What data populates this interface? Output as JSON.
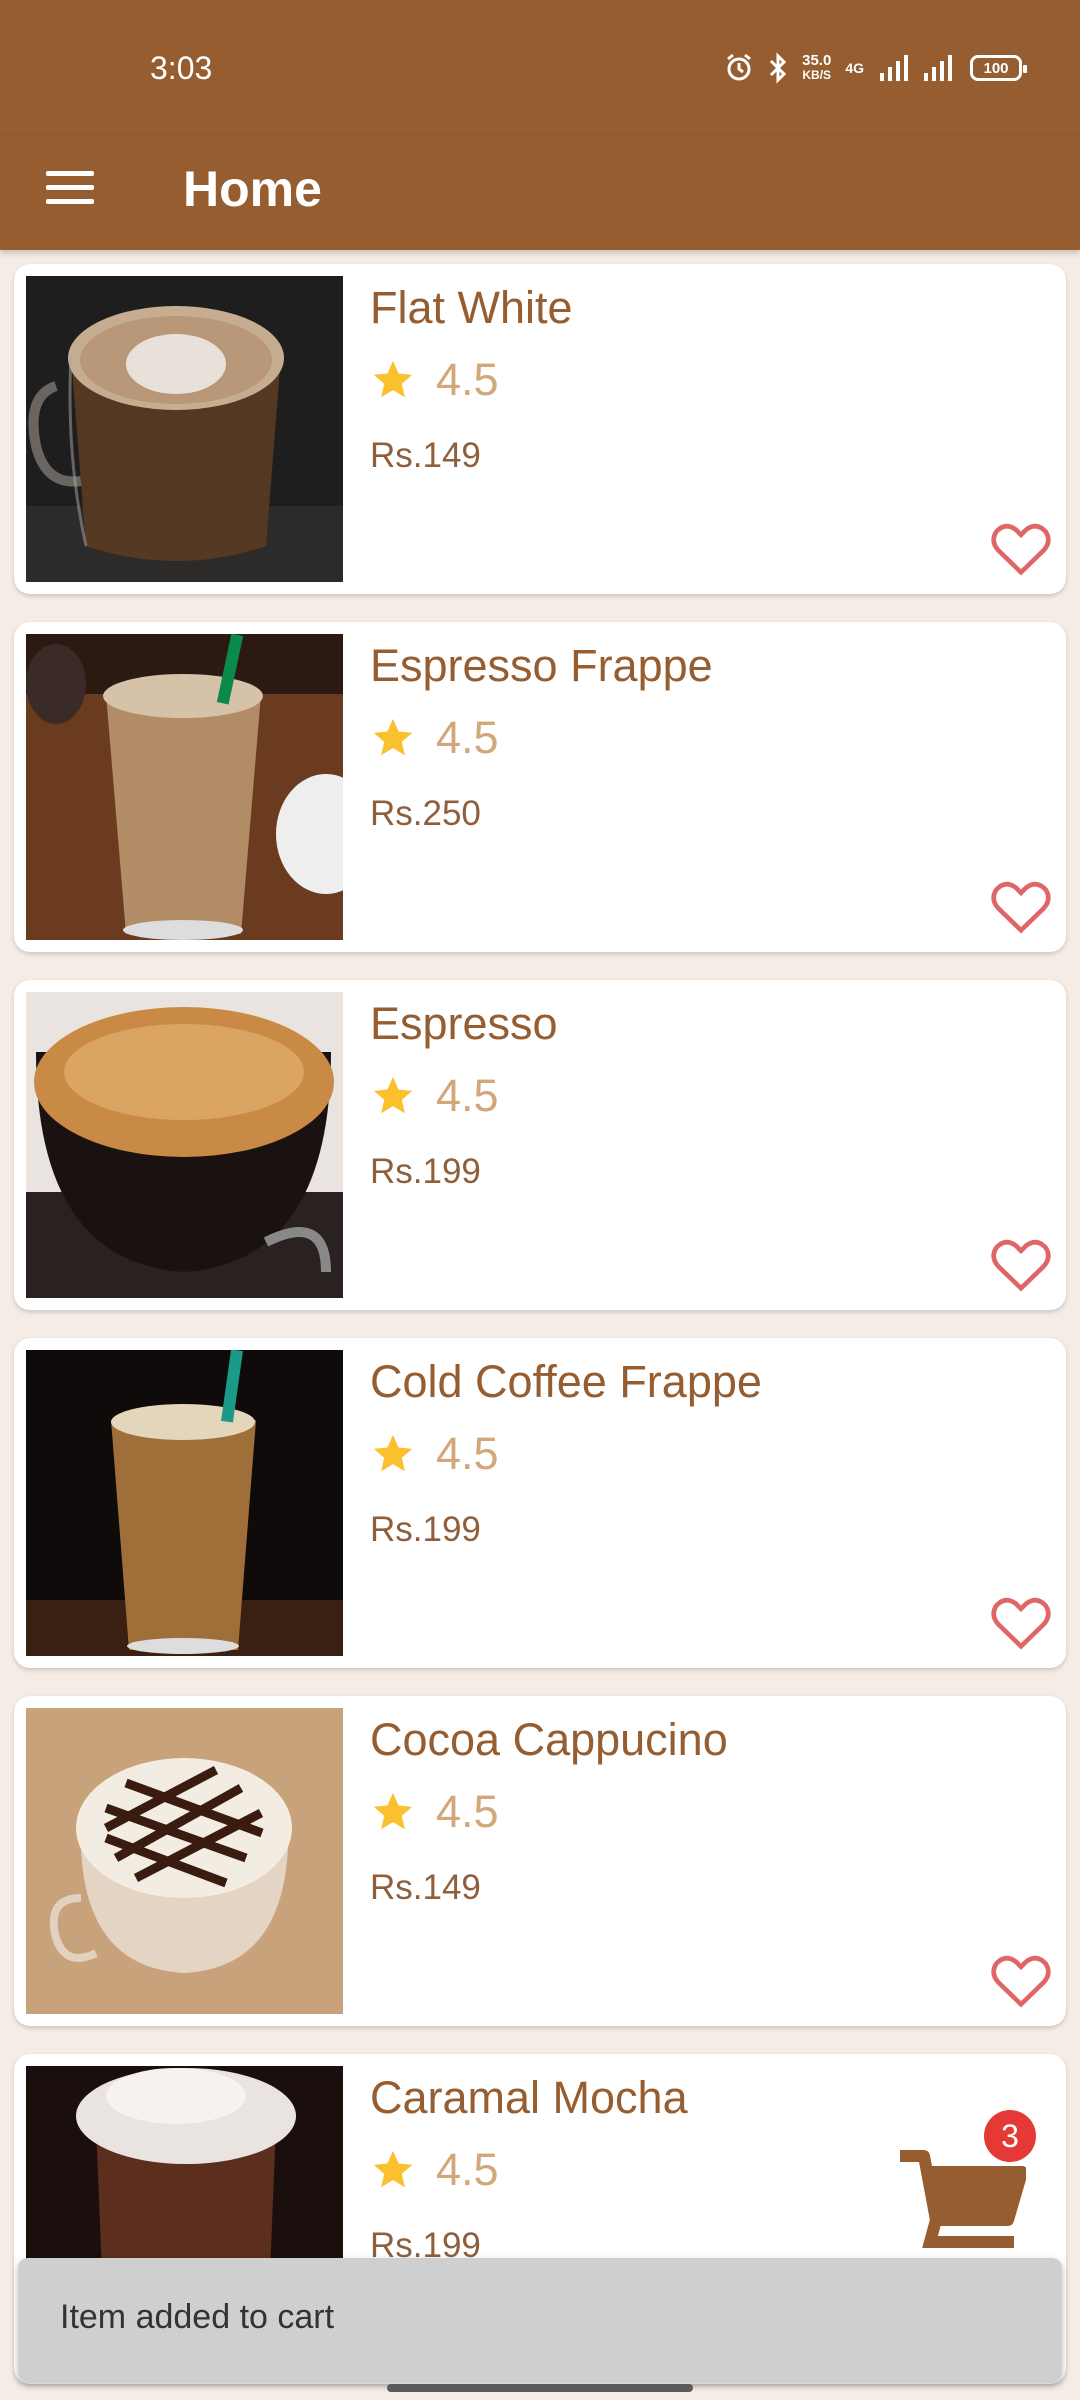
{
  "status_bar": {
    "time": "3:03",
    "net_speed": "35.0",
    "net_unit": "KB/S",
    "network_tag": "4G",
    "battery": "100"
  },
  "toolbar": {
    "title": "Home"
  },
  "items": [
    {
      "name": "Flat White",
      "rating": "4.5",
      "price": "Rs.149"
    },
    {
      "name": "Espresso Frappe",
      "rating": "4.5",
      "price": "Rs.250"
    },
    {
      "name": "Espresso",
      "rating": "4.5",
      "price": "Rs.199"
    },
    {
      "name": "Cold Coffee Frappe",
      "rating": "4.5",
      "price": "Rs.199"
    },
    {
      "name": "Cocoa Cappucino",
      "rating": "4.5",
      "price": "Rs.149"
    },
    {
      "name": "Caramal Mocha",
      "rating": "4.5",
      "price": "Rs.199"
    }
  ],
  "cart": {
    "badge_count": "3"
  },
  "snackbar": {
    "message": "Item added to cart"
  },
  "colors": {
    "primary": "#955d30",
    "background": "#f6ece6",
    "star": "#fbc02d",
    "heart": "#e06666",
    "badge": "#e53935"
  }
}
